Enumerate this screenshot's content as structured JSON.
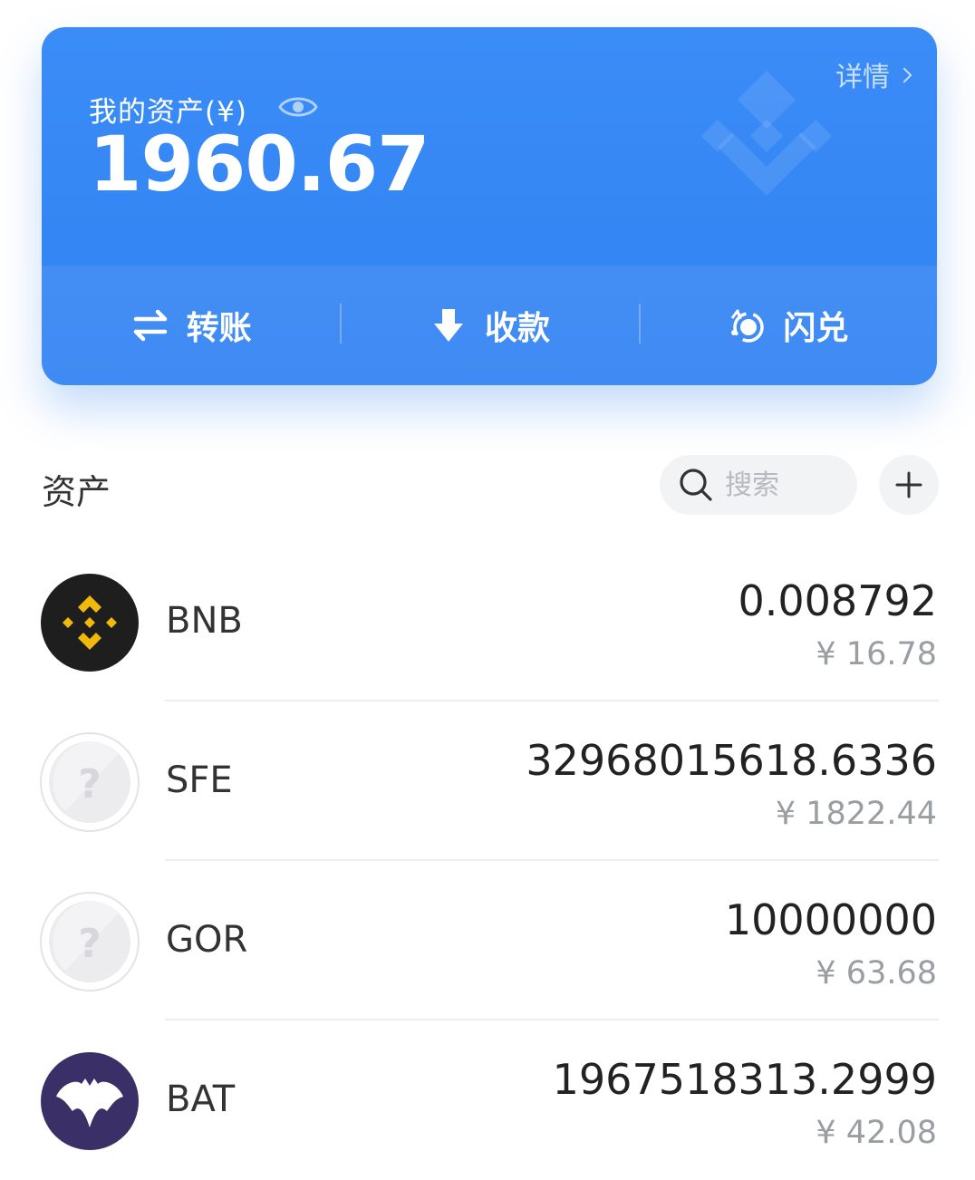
{
  "card": {
    "title": "我的资产(¥)",
    "total": "1960.67",
    "detail_label": "详情",
    "actions": [
      {
        "label": "转账",
        "icon": "transfer-icon"
      },
      {
        "label": "收款",
        "icon": "download-icon"
      },
      {
        "label": "闪兑",
        "icon": "swap-icon"
      }
    ],
    "colors": {
      "background": "#3b8cf7",
      "text": "#ffffff"
    }
  },
  "assets_section": {
    "title": "资产",
    "search": {
      "placeholder": "搜索",
      "value": ""
    },
    "add_icon": "plus-icon"
  },
  "assets": [
    {
      "symbol": "BNB",
      "amount": "0.008792",
      "fiat": "¥ 16.78",
      "icon": "bnb-logo-icon"
    },
    {
      "symbol": "SFE",
      "amount": "32968015618.6336",
      "fiat": "¥ 1822.44",
      "icon": "unknown-token-icon"
    },
    {
      "symbol": "GOR",
      "amount": "10000000",
      "fiat": "¥ 63.68",
      "icon": "unknown-token-icon"
    },
    {
      "symbol": "BAT",
      "amount": "1967518313.2999",
      "fiat": "¥ 42.08",
      "icon": "bat-logo-icon"
    }
  ]
}
